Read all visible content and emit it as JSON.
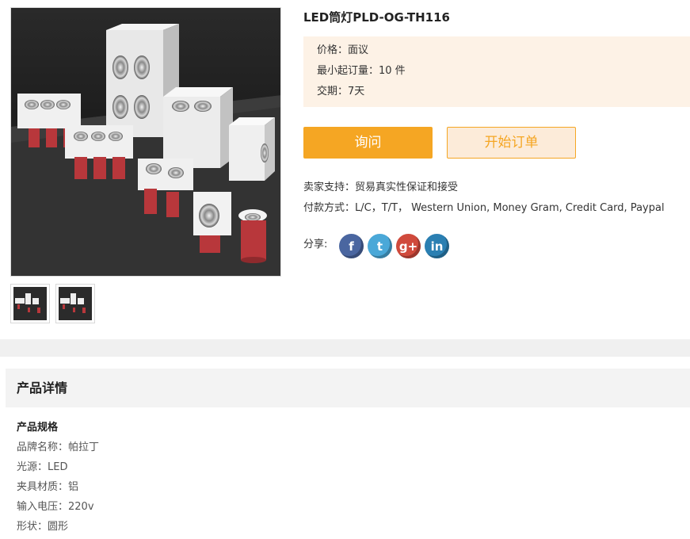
{
  "product": {
    "title": "LED筒灯PLD-OG-TH116",
    "price": "价格：面议",
    "moq": "最小起订量：10 件",
    "delivery": "交期：7天"
  },
  "buttons": {
    "inquire": "询问",
    "order": "开始订单"
  },
  "seller_support": "卖家支持：贸易真实性保证和接受",
  "payment": "付款方式：L/C，T/T，  Western Union, Money Gram, Credit Card, Paypal",
  "share": {
    "label": "分享:",
    "networks": [
      {
        "name": "facebook",
        "glyph": "f"
      },
      {
        "name": "twitter",
        "glyph": "t"
      },
      {
        "name": "google-plus",
        "glyph": "g+"
      },
      {
        "name": "linkedin",
        "glyph": "in"
      }
    ]
  },
  "details": {
    "header": "产品详情",
    "spec_title": "产品规格",
    "specs": [
      "品牌名称：帕拉丁",
      "光源：LED",
      "夹具材质：铝",
      "输入电压：220v",
      "形状：圆形"
    ]
  },
  "colors": {
    "accent": "#f5a623",
    "price_bg": "#fdf2e6"
  }
}
